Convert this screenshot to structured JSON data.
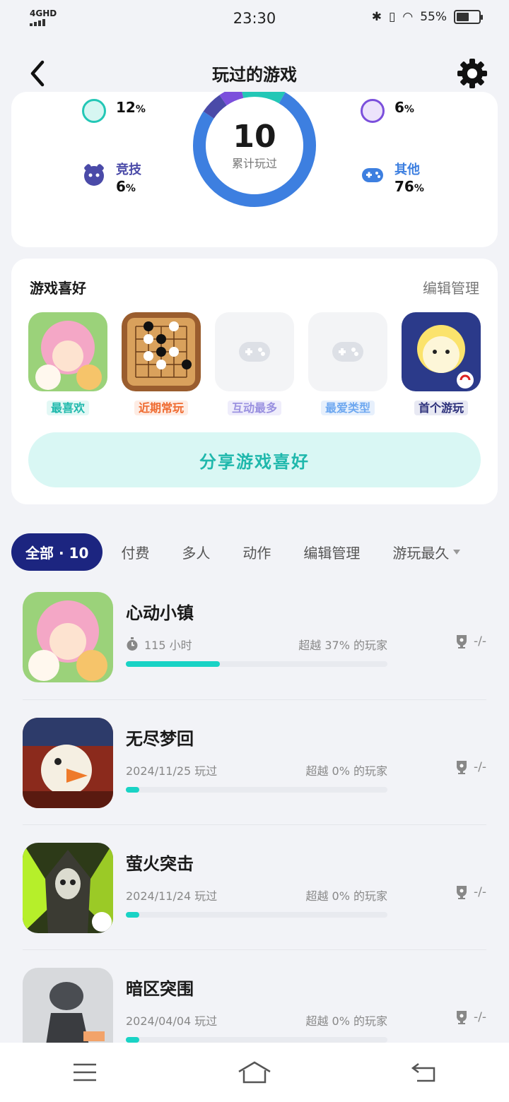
{
  "status_bar": {
    "network": "4GHD",
    "time": "23:30",
    "battery": "55%",
    "battery_level": 0.55
  },
  "header": {
    "title": "玩过的游戏"
  },
  "stats": {
    "total": "10",
    "total_label": "累计玩过",
    "categories": [
      {
        "label": "",
        "percent": "12",
        "color": "#23c7b6"
      },
      {
        "label": "",
        "percent": "6",
        "color": "#7b4fdc"
      },
      {
        "label": "竞技",
        "percent": "6",
        "color": "#4a4aa8"
      },
      {
        "label": "其他",
        "percent": "76",
        "color": "#3d7fe0"
      }
    ],
    "percent_sign": "%"
  },
  "preferences": {
    "title": "游戏喜好",
    "edit": "编辑管理",
    "tiles": [
      {
        "tag": "最喜欢",
        "tag_color": "#1fb8ac",
        "tag_bg": "#e3f8f5"
      },
      {
        "tag": "近期常玩",
        "tag_color": "#ef6a2f",
        "tag_bg": "#fdece4"
      },
      {
        "tag": "互动最多",
        "tag_color": "#9a91e0",
        "tag_bg": "#efedfb"
      },
      {
        "tag": "最爱类型",
        "tag_color": "#6ea8f0",
        "tag_bg": "#e7f0fc"
      },
      {
        "tag": "首个游玩",
        "tag_color": "#2b2f7a",
        "tag_bg": "#e8e9f3"
      }
    ],
    "share": "分享游戏喜好"
  },
  "tabs": [
    "全部 · 10",
    "付费",
    "多人",
    "动作",
    "编辑管理",
    "游玩最久"
  ],
  "games": [
    {
      "name": "心动小镇",
      "meta": "115 小时",
      "beat": "超越 37% 的玩家",
      "progress": 0.36,
      "trophy": "-/-"
    },
    {
      "name": "无尽梦回",
      "meta": "2024/11/25 玩过",
      "beat": "超越 0% 的玩家",
      "progress": 0.05,
      "trophy": "-/-"
    },
    {
      "name": "萤火突击",
      "meta": "2024/11/24 玩过",
      "beat": "超越 0% 的玩家",
      "progress": 0.05,
      "trophy": "-/-"
    },
    {
      "name": "暗区突围",
      "meta": "2024/04/04 玩过",
      "beat": "超越 0% 的玩家",
      "progress": 0.05,
      "trophy": "-/-"
    }
  ],
  "icons": {
    "back": "chevron-left-icon",
    "settings": "gear-icon",
    "timer": "stopwatch-icon",
    "trophy": "trophy-icon"
  }
}
